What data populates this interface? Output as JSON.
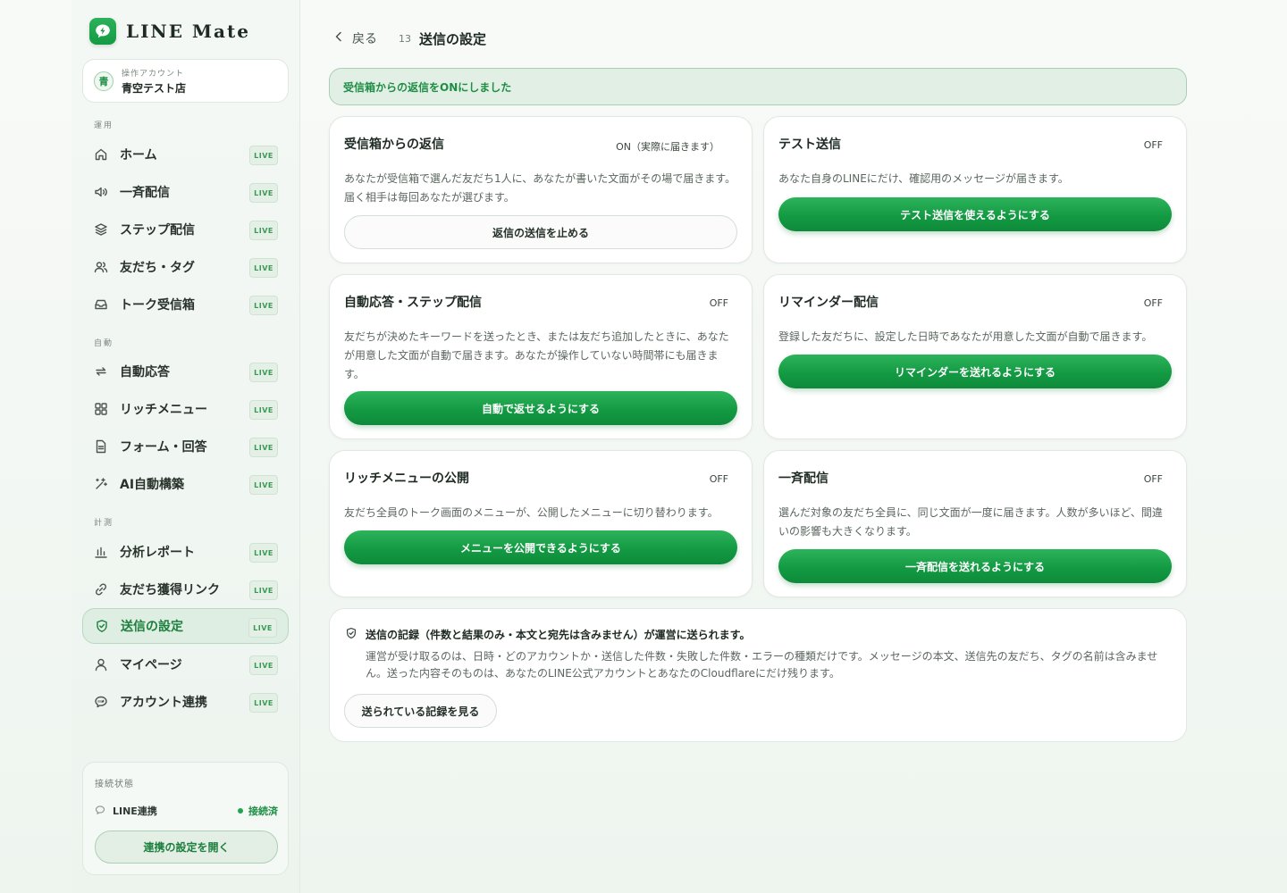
{
  "brand": {
    "name": "LINE Mate"
  },
  "account": {
    "caption": "操作アカウント",
    "avatar": "青",
    "name": "青空テスト店"
  },
  "sidebar": {
    "sections": {
      "operation": "運用",
      "automation": "自動",
      "measurement": "計測"
    },
    "badge": "LIVE",
    "items": [
      {
        "label": "ホーム",
        "icon": "home-icon"
      },
      {
        "label": "一斉配信",
        "icon": "megaphone-icon"
      },
      {
        "label": "ステップ配信",
        "icon": "layers-icon"
      },
      {
        "label": "友だち・タグ",
        "icon": "users-icon"
      },
      {
        "label": "トーク受信箱",
        "icon": "inbox-icon"
      },
      {
        "label": "自動応答",
        "icon": "repeat-icon"
      },
      {
        "label": "リッチメニュー",
        "icon": "grid-icon"
      },
      {
        "label": "フォーム・回答",
        "icon": "document-icon"
      },
      {
        "label": "AI自動構築",
        "icon": "sparkle-icon"
      },
      {
        "label": "分析レポート",
        "icon": "bar-chart-icon"
      },
      {
        "label": "友だち獲得リンク",
        "icon": "link-icon"
      },
      {
        "label": "送信の設定",
        "icon": "shield-check-icon",
        "active": true
      },
      {
        "label": "マイページ",
        "icon": "user-icon"
      },
      {
        "label": "アカウント連携",
        "icon": "line-chat-icon"
      }
    ]
  },
  "status": {
    "title": "接続状態",
    "line_label": "LINE連携",
    "line_value": "接続済",
    "button": "連携の設定を開く"
  },
  "topbar": {
    "back": "戻る",
    "step": "13",
    "title": "送信の設定"
  },
  "notice": "受信箱からの返信をONにしました",
  "cards": {
    "inbox": {
      "title": "受信箱からの返信",
      "state": "ON（実際に届きます）",
      "desc": "あなたが受信箱で選んだ友だち1人に、あなたが書いた文面がその場で届きます。届く相手は毎回あなたが選びます。",
      "button": "返信の送信を止める"
    },
    "test": {
      "title": "テスト送信",
      "state": "OFF",
      "desc": "あなた自身のLINEにだけ、確認用のメッセージが届きます。",
      "button": "テスト送信を使えるようにする"
    },
    "auto": {
      "title": "自動応答・ステップ配信",
      "state": "OFF",
      "desc": "友だちが決めたキーワードを送ったとき、または友だち追加したときに、あなたが用意した文面が自動で届きます。あなたが操作していない時間帯にも届きます。",
      "button": "自動で返せるようにする"
    },
    "reminder": {
      "title": "リマインダー配信",
      "state": "OFF",
      "desc": "登録した友だちに、設定した日時であなたが用意した文面が自動で届きます。",
      "button": "リマインダーを送れるようにする"
    },
    "richmenu": {
      "title": "リッチメニューの公開",
      "state": "OFF",
      "desc": "友だち全員のトーク画面のメニューが、公開したメニューに切り替わります。",
      "button": "メニューを公開できるようにする"
    },
    "broadcast": {
      "title": "一斉配信",
      "state": "OFF",
      "desc": "選んだ対象の友だち全員に、同じ文面が一度に届きます。人数が多いほど、間違いの影響も大きくなります。",
      "button": "一斉配信を送れるようにする"
    }
  },
  "log": {
    "title": "送信の記録（件数と結果のみ・本文と宛先は含みません）が運営に送られます。",
    "desc": "運営が受け取るのは、日時・どのアカウントか・送信した件数・失敗した件数・エラーの種類だけです。メッセージの本文、送信先の友だち、タグの名前は含みません。送った内容そのものは、あなたのLINE公式アカウントとあなたのCloudflareにだけ残ります。",
    "button": "送られている記録を見る"
  },
  "colors": {
    "accent": "#139a43",
    "accent_light": "#e1efe4",
    "text": "#1f2a23"
  }
}
